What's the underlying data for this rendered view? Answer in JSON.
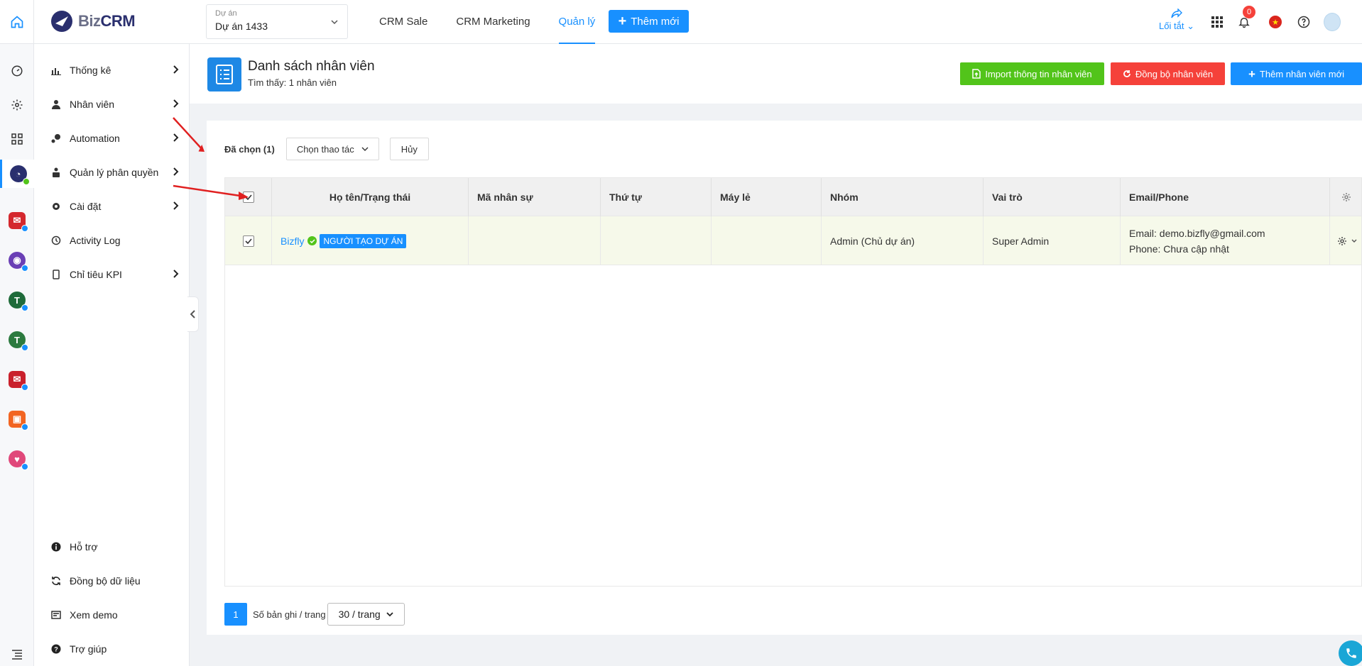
{
  "app": {
    "logo_text_1": "Biz",
    "logo_text_2": "CRM"
  },
  "project": {
    "label": "Dự án",
    "value": "Dự án 1433"
  },
  "topnav": [
    {
      "label": "CRM Sale",
      "active": false
    },
    {
      "label": "CRM Marketing",
      "active": false
    },
    {
      "label": "Quản lý",
      "active": true
    }
  ],
  "add_new_label": "Thêm mới",
  "topright": {
    "shortcut_label": "Lối tắt",
    "notification_count": "0"
  },
  "sidebar": {
    "items": [
      {
        "label": "Thống kê",
        "icon": "bar-chart-icon",
        "has_arrow": true
      },
      {
        "label": "Nhân viên",
        "icon": "user-icon",
        "has_arrow": true
      },
      {
        "label": "Automation",
        "icon": "automation-icon",
        "has_arrow": true
      },
      {
        "label": "Quản lý phân quyền",
        "icon": "permission-icon",
        "has_arrow": true
      },
      {
        "label": "Cài đặt",
        "icon": "gear-icon",
        "has_arrow": true
      },
      {
        "label": "Activity Log",
        "icon": "history-icon",
        "has_arrow": false
      },
      {
        "label": "Chỉ tiêu KPI",
        "icon": "mobile-icon",
        "has_arrow": true
      }
    ],
    "bottom_items": [
      {
        "label": "Hỗ trợ",
        "icon": "info-icon"
      },
      {
        "label": "Đồng bộ dữ liệu",
        "icon": "sync-icon"
      },
      {
        "label": "Xem demo",
        "icon": "demo-icon"
      },
      {
        "label": "Trợ giúp",
        "icon": "help-icon"
      }
    ]
  },
  "page": {
    "title": "Danh sách nhân viên",
    "subtitle": "Tìm thấy: 1 nhân viên",
    "buttons": {
      "import": "Import thông tin nhân viên",
      "sync": "Đồng bộ nhân viên",
      "add": "Thêm nhân viên mới"
    }
  },
  "selection": {
    "selected_label": "Đã chọn (1)",
    "action_label": "Chọn thao tác",
    "cancel_label": "Hủy"
  },
  "table": {
    "columns": [
      "Họ tên/Trạng thái",
      "Mã nhân sự",
      "Thứ tự",
      "Máy lẻ",
      "Nhóm",
      "Vai trò",
      "Email/Phone"
    ],
    "rows": [
      {
        "name": "Bizfly",
        "tag": "NGƯỜI TẠO DỰ ÁN",
        "code": "",
        "order": "",
        "ext": "",
        "group": "Admin (Chủ dự án)",
        "role": "Super Admin",
        "email": "Email: demo.bizfly@gmail.com",
        "phone": "Phone: Chưa cập nhật",
        "checked": true
      }
    ]
  },
  "pagination": {
    "current_page": "1",
    "per_page_label": "Số bản ghi / trang",
    "per_page_value": "30 / trang"
  },
  "colors": {
    "primary": "#1890ff",
    "success": "#52c41a",
    "danger": "#f5413a",
    "row_selected": "#f6f9ea"
  }
}
